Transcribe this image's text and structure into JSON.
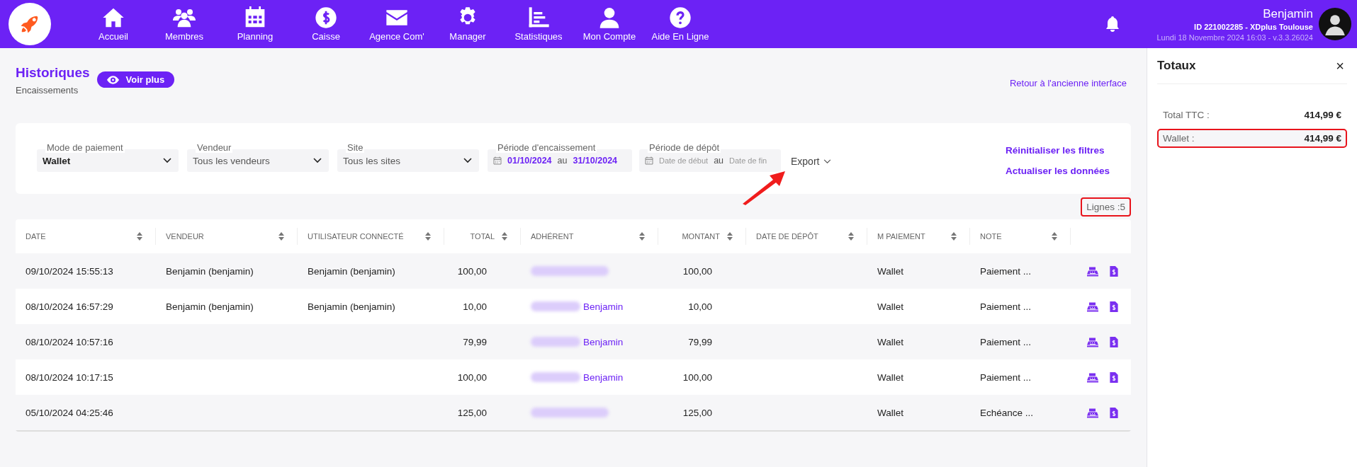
{
  "topbar": {
    "nav": [
      {
        "label": "Accueil"
      },
      {
        "label": "Membres"
      },
      {
        "label": "Planning"
      },
      {
        "label": "Caisse"
      },
      {
        "label": "Agence Com'"
      },
      {
        "label": "Manager"
      },
      {
        "label": "Statistiques"
      },
      {
        "label": "Mon Compte"
      },
      {
        "label": "Aide En Ligne"
      }
    ],
    "user": {
      "name": "Benjamin",
      "account": "ID 221002285 - XDplus Toulouse",
      "date_version": "Lundi 18 Novembre 2024 16:03 - v.3.3.26024"
    }
  },
  "header": {
    "title": "Historiques",
    "subtitle": "Encaissements",
    "more_button": "Voir plus",
    "back_link": "Retour à l'ancienne interface"
  },
  "filters": [
    {
      "kind": "select",
      "label": "Mode de paiement",
      "value": "Wallet"
    },
    {
      "kind": "select",
      "label": "Vendeur",
      "value": "Tous les vendeurs"
    },
    {
      "kind": "select",
      "label": "Site",
      "value": "Tous les sites"
    },
    {
      "kind": "range",
      "label": "Période d'encaissement",
      "from": "01/10/2024",
      "sep": "au",
      "to": "31/10/2024"
    },
    {
      "kind": "range",
      "label": "Période de dépôt",
      "from_placeholder": "Date de début",
      "sep": "au",
      "to_placeholder": "Date de fin"
    }
  ],
  "export": {
    "label": "Export",
    "annotated": true
  },
  "actions": [
    "Réinitialiser les filtres",
    "Actualiser les données"
  ],
  "line_count": {
    "text": "Lignes :5",
    "highlighted": true
  },
  "table": {
    "columns": [
      "DATE",
      "VENDEUR",
      "UTILISATEUR CONNECTÉ",
      "TOTAL",
      "ADHÉRENT",
      "MONTANT",
      "DATE DE DÉPÔT",
      "M PAIEMENT",
      "NOTE"
    ],
    "rows": [
      {
        "date": "09/10/2024 15:55:13",
        "vendeur": "Benjamin (benjamin)",
        "utilisateur": "Benjamin (benjamin)",
        "total": "100,00",
        "montant": "100,00",
        "paiement": "Wallet",
        "note": "Paiement ..."
      },
      {
        "date": "08/10/2024 16:57:29",
        "vendeur": "Benjamin (benjamin)",
        "utilisateur": "Benjamin (benjamin)",
        "total": "10,00",
        "adherent": "Benjamin",
        "montant": "10,00",
        "paiement": "Wallet",
        "note": "Paiement ..."
      },
      {
        "date": "08/10/2024 10:57:16",
        "total": "79,99",
        "adherent": "Benjamin",
        "montant": "79,99",
        "paiement": "Wallet",
        "note": "Paiement ..."
      },
      {
        "date": "08/10/2024 10:17:15",
        "total": "100,00",
        "adherent": "Benjamin",
        "montant": "100,00",
        "paiement": "Wallet",
        "note": "Paiement ..."
      },
      {
        "date": "05/10/2024 04:25:46",
        "total": "125,00",
        "montant": "125,00",
        "paiement": "Wallet",
        "note": "Echéance ..."
      }
    ]
  },
  "totals": {
    "title": "Totaux",
    "close": "×",
    "lines": [
      {
        "label": "Total TTC :",
        "value": "414,99 €",
        "highlighted": false
      },
      {
        "label": "Wallet :",
        "value": "414,99 €",
        "highlighted": true
      }
    ]
  }
}
